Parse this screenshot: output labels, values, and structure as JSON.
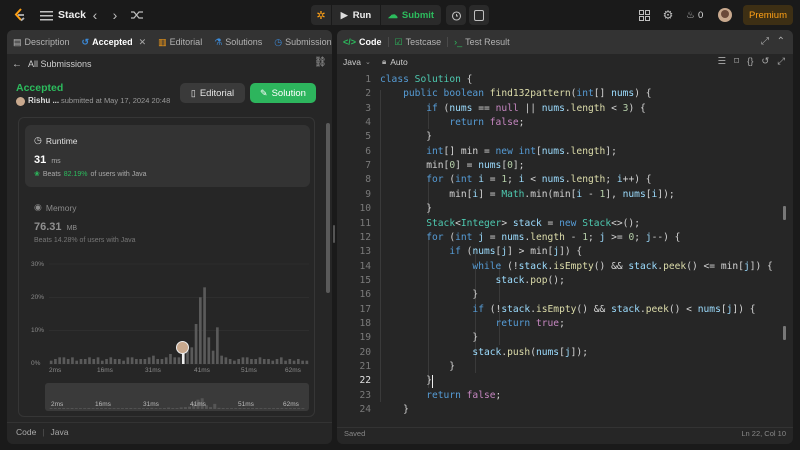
{
  "topbar": {
    "problem_list_label": "Stack",
    "run_label": "Run",
    "submit_label": "Submit",
    "streak_count": "0",
    "premium_label": "Premium"
  },
  "left_tabs": [
    {
      "label": "Description",
      "icon": "description-icon"
    },
    {
      "label": "Accepted",
      "icon": "history-icon"
    },
    {
      "label": "Editorial",
      "icon": "editorial-icon"
    },
    {
      "label": "Solutions",
      "icon": "flask-icon"
    },
    {
      "label": "Submission",
      "icon": "clock-icon"
    }
  ],
  "submission": {
    "back_label": "All Submissions",
    "status": "Accepted",
    "user": "Rishu ...",
    "submitted_at": "submitted at May 17, 2024 20:48",
    "editorial_button": "Editorial",
    "solution_button": "Solution",
    "runtime": {
      "label": "Runtime",
      "value": "31",
      "unit": "ms",
      "beats_prefix": "Beats",
      "beats_pct": "82.19%",
      "beats_suffix": "of users with Java"
    },
    "memory": {
      "label": "Memory",
      "value": "76.31",
      "unit": "MB",
      "beats_text": "Beats 14.28% of users with Java"
    },
    "footer_lang_label": "Code",
    "footer_lang": "Java"
  },
  "chart_data": {
    "type": "bar",
    "y_ticks": [
      "30%",
      "20%",
      "10%",
      "0%"
    ],
    "x_ticks": [
      "2ms",
      "16ms",
      "31ms",
      "41ms",
      "51ms",
      "62ms"
    ],
    "minimap_ticks": [
      "2ms",
      "16ms",
      "31ms",
      "41ms",
      "51ms",
      "62ms"
    ],
    "ylim": [
      0,
      30
    ],
    "values": [
      1,
      1.5,
      2,
      2,
      1.5,
      2,
      1,
      1.5,
      1.5,
      2,
      1.5,
      2,
      1,
      1.5,
      2,
      1.5,
      1.5,
      1,
      2,
      2,
      1.5,
      1.5,
      1.5,
      2,
      2.5,
      1.5,
      1.5,
      2,
      3,
      2,
      2,
      3.5,
      4,
      5,
      12,
      20,
      23,
      8,
      4,
      11,
      2.5,
      2,
      1.5,
      1,
      1.5,
      2,
      2,
      1.5,
      1.5,
      2,
      1.5,
      1.5,
      1,
      1.5,
      2,
      1,
      1.5,
      1,
      1.5,
      1,
      1
    ],
    "highlight_index": 31,
    "colors": {
      "bar": "#5a5a5a",
      "highlight": "#eeeeee"
    }
  },
  "code_tabs": [
    {
      "label": "Code"
    },
    {
      "label": "Testcase"
    },
    {
      "label": "Test Result"
    }
  ],
  "editor": {
    "language": "Java",
    "auto_label": "Auto",
    "status_left": "Saved",
    "status_right": "Ln 22, Col 10",
    "lines": [
      "class Solution {",
      "    public boolean find132pattern(int[] nums) {",
      "        if (nums == null || nums.length < 3) {",
      "            return false;",
      "        }",
      "        int[] min = new int[nums.length];",
      "        min[0] = nums[0];",
      "        for (int i = 1; i < nums.length; i++) {",
      "            min[i] = Math.min(min[i - 1], nums[i]);",
      "        }",
      "        Stack<Integer> stack = new Stack<>();",
      "        for (int j = nums.length - 1; j >= 0; j--) {",
      "            if (nums[j] > min[j]) {",
      "                while (!stack.isEmpty() && stack.peek() <= min[j]) {",
      "                    stack.pop();",
      "                }",
      "                if (!stack.isEmpty() && stack.peek() < nums[j]) {",
      "                    return true;",
      "                }",
      "                stack.push(nums[j]);",
      "            }",
      "        }",
      "        return false;",
      "    }"
    ]
  },
  "colors": {
    "accepted_green": "#2cbb5d",
    "solution_btn": "#2db55d",
    "premium": "#ffa116",
    "beats_green": "#2cbb5d"
  }
}
